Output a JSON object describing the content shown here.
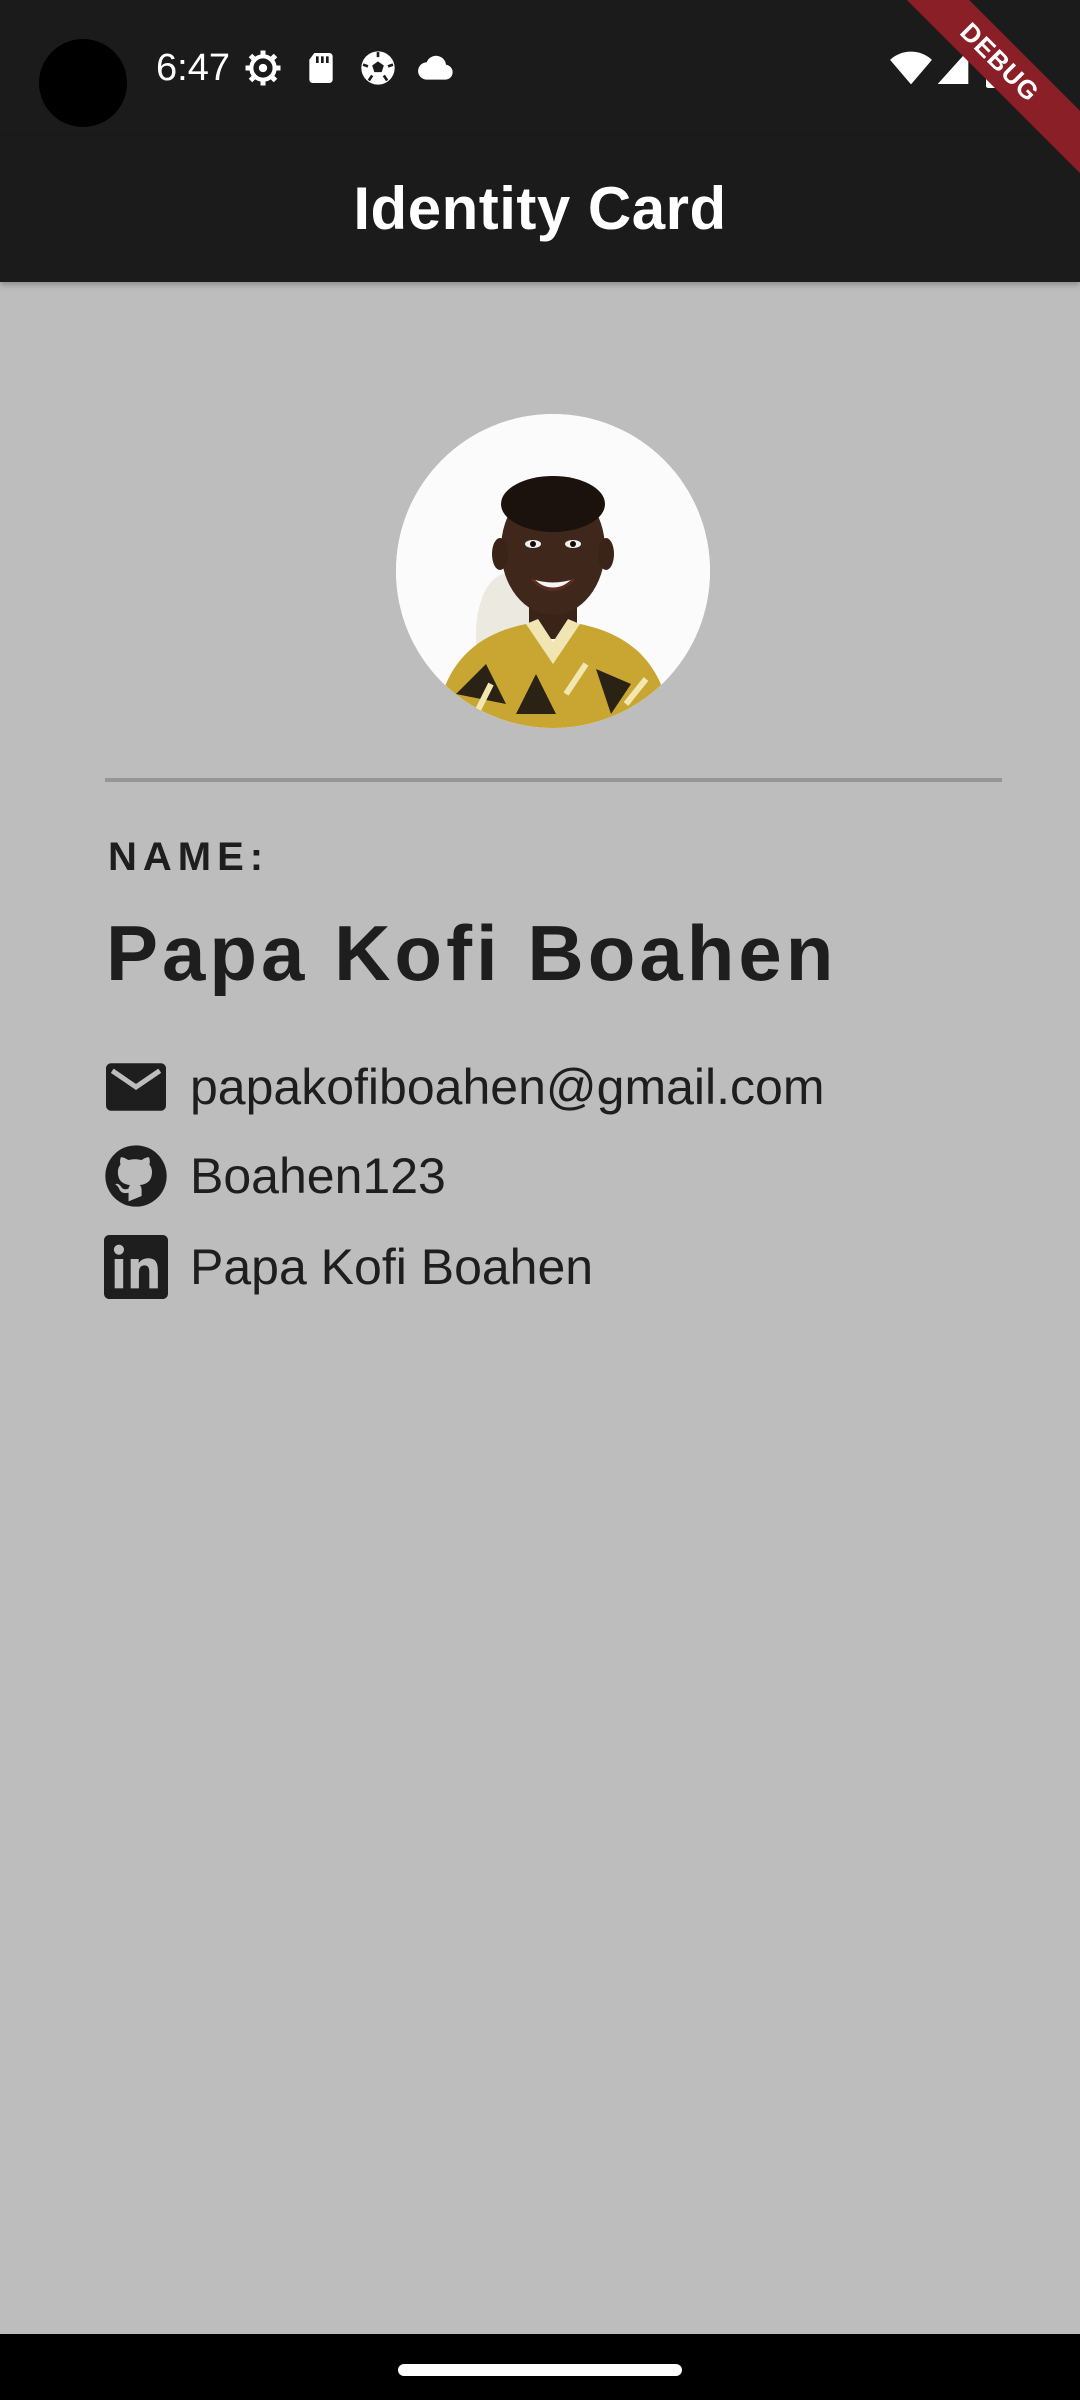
{
  "status_bar": {
    "time": "6:47",
    "left_icons": [
      "settings-gear-icon",
      "sd-card-icon",
      "soccer-ball-icon",
      "cloud-icon"
    ],
    "right_icons": [
      "wifi-icon",
      "cellular-signal-icon",
      "battery-icon"
    ]
  },
  "debug_banner": "DEBUG",
  "app_bar": {
    "title": "Identity Card"
  },
  "profile": {
    "name_label": "NAME:",
    "full_name": "Papa Kofi Boahen"
  },
  "contacts": [
    {
      "icon": "email-icon",
      "text": "papakofiboahen@gmail.com"
    },
    {
      "icon": "github-icon",
      "text": "Boahen123"
    },
    {
      "icon": "linkedin-icon",
      "text": "Papa Kofi Boahen"
    }
  ],
  "colors": {
    "background": "#bdbdbd",
    "app_bar": "#1b1b1b",
    "text": "#1e1e1e",
    "debug_banner": "#8b1f27"
  }
}
